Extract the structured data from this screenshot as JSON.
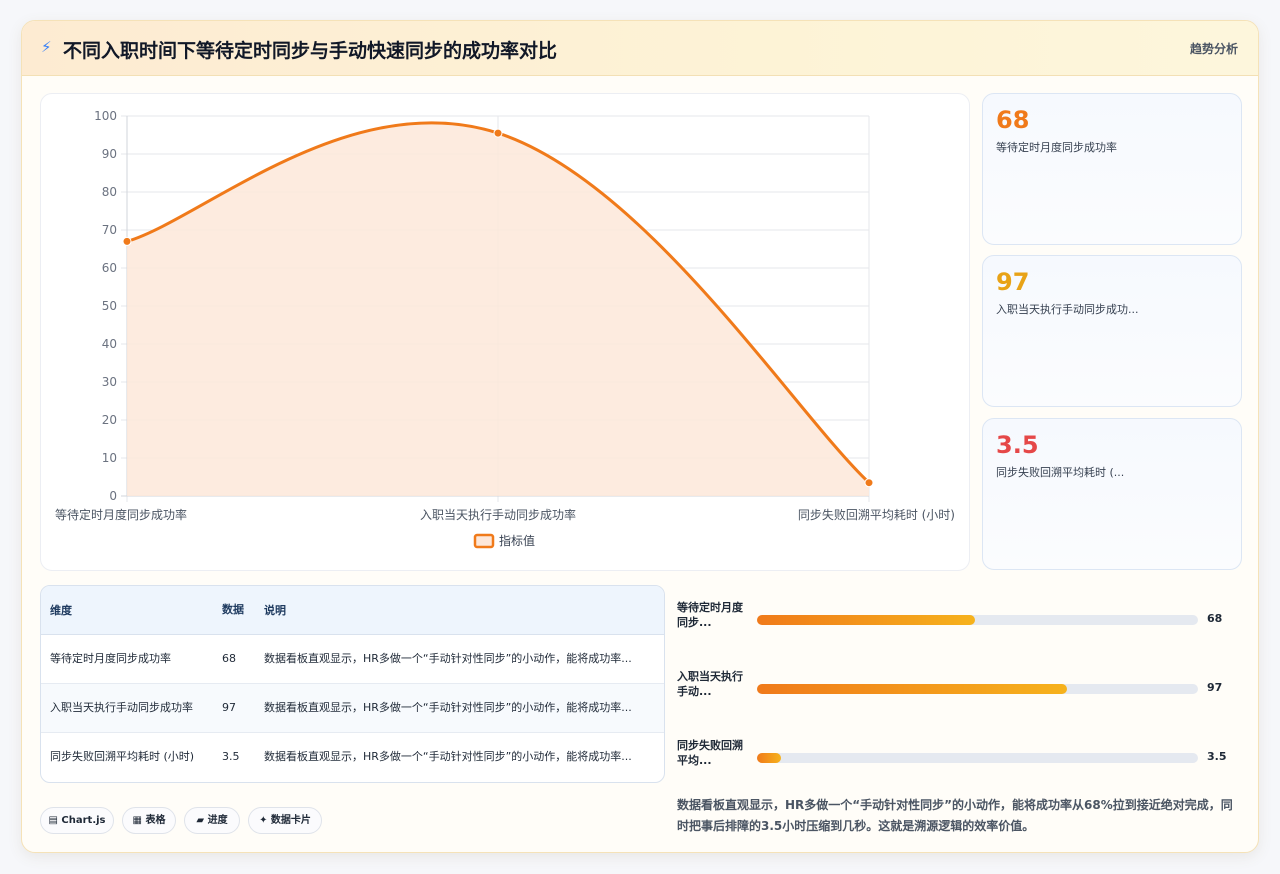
{
  "header": {
    "icon": "bolt-icon",
    "title": "不同入职时间下等待定时同步与手动快速同步的成功率对比",
    "tag": "趋势分析"
  },
  "colors": {
    "line": "#f07a1a",
    "area": "#fde7d9",
    "card_values": [
      "#f07a1a",
      "#e8a317",
      "#e54848"
    ]
  },
  "chart_data": {
    "type": "area",
    "categories": [
      "等待定时月度同步成功率",
      "入职当天执行手动同步成功率",
      "同步失败回溯平均耗时 (小时)"
    ],
    "series": [
      {
        "name": "指标值",
        "values": [
          67,
          95.5,
          3.5
        ]
      }
    ],
    "ylim": [
      0,
      100
    ],
    "yticks": [
      0,
      10,
      20,
      30,
      40,
      50,
      60,
      70,
      80,
      90,
      100
    ],
    "grid": true,
    "legend": "bottom",
    "smooth": true
  },
  "cards": [
    {
      "value": "68",
      "label": "等待定时月度同步成功率"
    },
    {
      "value": "97",
      "label": "入职当天执行手动同步成功..."
    },
    {
      "value": "3.5",
      "label": "同步失败回溯平均耗时 (..."
    }
  ],
  "table": {
    "headers": [
      "维度",
      "数据",
      "说明"
    ],
    "rows": [
      {
        "dim": "等待定时月度同步成功率",
        "val": "68",
        "desc": "数据看板直观显示，HR多做一个“手动针对性同步”的小动作，能将成功率..."
      },
      {
        "dim": "入职当天执行手动同步成功率",
        "val": "97",
        "desc": "数据看板直观显示，HR多做一个“手动针对性同步”的小动作，能将成功率..."
      },
      {
        "dim": "同步失败回溯平均耗时 (小时)",
        "val": "3.5",
        "desc": "数据看板直观显示，HR多做一个“手动针对性同步”的小动作，能将成功率..."
      }
    ]
  },
  "badges": [
    {
      "icon": "chart-icon",
      "label": "▤ Chart.js"
    },
    {
      "icon": "table-icon",
      "label": "▦ 表格"
    },
    {
      "icon": "progress-icon",
      "label": "▰ 进度"
    },
    {
      "icon": "card-icon",
      "label": "✦ 数据卡片"
    }
  ],
  "bars": [
    {
      "label": "等待定时月度同步...",
      "value": "68",
      "fraction": 0.494
    },
    {
      "label": "入职当天执行手动...",
      "value": "97",
      "fraction": 0.704
    },
    {
      "label": "同步失败回溯平均...",
      "value": "3.5",
      "fraction": 0.055
    }
  ],
  "summary": "数据看板直观显示，HR多做一个“手动针对性同步”的小动作，能将成功率从68%拉到接近绝对完成，同时把事后排障的3.5小时压缩到几秒。这就是溯源逻辑的效率价值。"
}
